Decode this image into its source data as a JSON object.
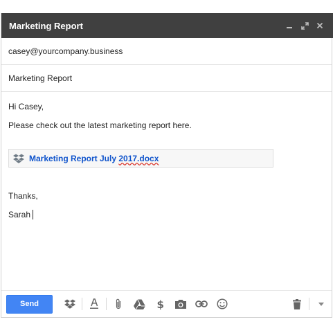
{
  "window": {
    "title": "Marketing Report",
    "controls": [
      "minimize-icon",
      "expand-icon",
      "close-icon"
    ]
  },
  "compose": {
    "to": "casey@yourcompany.business",
    "subject": "Marketing Report",
    "body": {
      "greeting": "Hi Casey,",
      "line1": "Please check out the latest marketing report here.",
      "attachment": {
        "icon": "dropbox-icon",
        "name_part1": "Marketing Report July ",
        "name_part2": "2017.docx"
      },
      "closing": "Thanks,",
      "signature": "Sarah"
    }
  },
  "toolbar": {
    "send_label": "Send",
    "icons": [
      "dropbox-icon",
      "text-format-icon",
      "attach-icon",
      "drive-icon",
      "money-icon",
      "camera-icon",
      "link-icon",
      "emoji-icon",
      "trash-icon",
      "more-options-icon"
    ]
  },
  "colors": {
    "titlebar": "#404040",
    "send_button": "#4285f4",
    "link": "#1155cc"
  }
}
